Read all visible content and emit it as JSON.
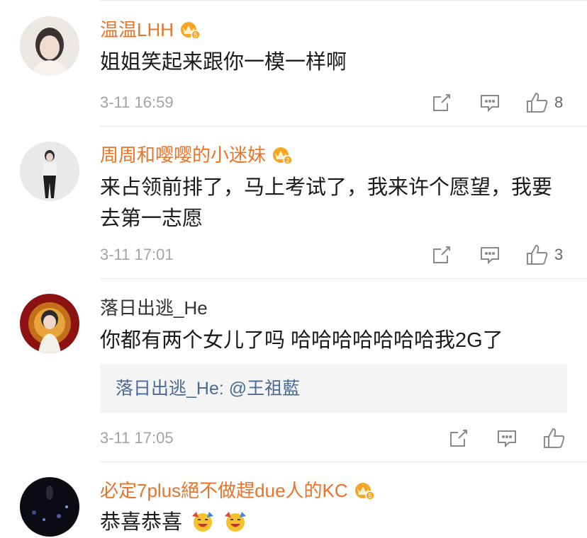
{
  "comments": [
    {
      "username": "温温LHH",
      "username_color": "#e8742a",
      "badge_icon": "vip-crown-icon",
      "badge_level": "5",
      "text": "姐姐笑起来跟你一模一样啊",
      "timestamp": "3-11 16:59",
      "like_count": "8"
    },
    {
      "username": "周周和嘤嘤的小迷妹",
      "username_color": "#e8742a",
      "badge_icon": "vip-crown-icon",
      "badge_level": "2",
      "text": "来占领前排了，马上考试了，我来许个愿望，我要去第一志愿",
      "timestamp": "3-11 17:01",
      "like_count": "3"
    },
    {
      "username": "落日出逃_He",
      "username_color": "#333333",
      "text": "你都有两个女儿了吗  哈哈哈哈哈哈哈我2G了",
      "reply": "落日出逃_He: @王祖藍",
      "timestamp": "3-11 17:05",
      "like_count": ""
    },
    {
      "username": "必定7plus絕不做趕due人的KC",
      "username_color": "#e8742a",
      "badge_icon": "vip-crown-icon",
      "badge_level": "5",
      "text": "恭喜恭喜",
      "text_emojis": [
        "cheering-emoji",
        "cheering-emoji"
      ]
    }
  ],
  "icons": {
    "share": "share-icon",
    "comment": "comment-icon",
    "like": "thumbs-up-icon"
  },
  "colors": {
    "vip_name": "#e8742a",
    "timestamp": "#a3a3a3",
    "reply_link": "#4a6a96",
    "reply_bg": "#f4f4f4"
  }
}
